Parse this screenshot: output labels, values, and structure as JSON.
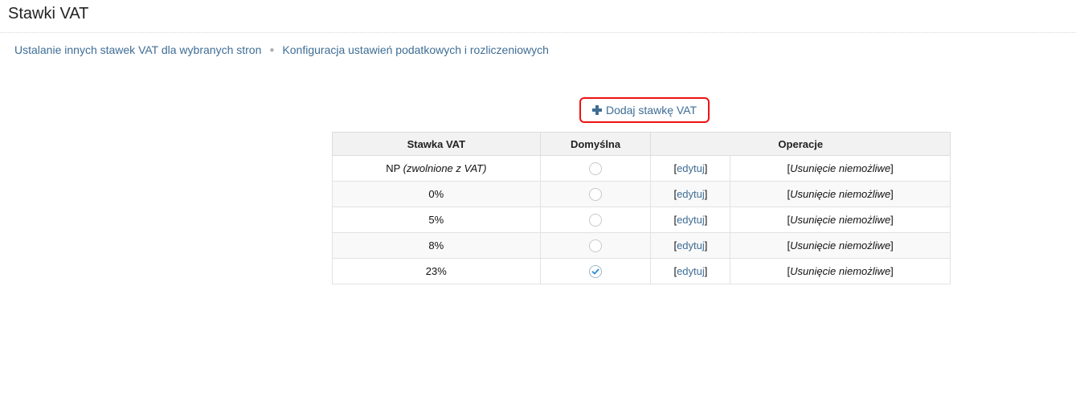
{
  "page": {
    "title": "Stawki VAT"
  },
  "links": [
    {
      "label": "Ustalanie innych stawek VAT dla wybranych stron"
    },
    {
      "label": "Konfiguracja ustawień podatkowych i rozliczeniowych"
    }
  ],
  "add_button": {
    "label": "Dodaj stawkę VAT",
    "icon": "plus-icon"
  },
  "table": {
    "headers": {
      "rate": "Stawka VAT",
      "default": "Domyślna",
      "operations": "Operacje"
    },
    "rows": [
      {
        "rate": "NP",
        "rate_note": "(zwolnione z VAT)",
        "default": false,
        "edit": "edytuj",
        "delete": "Usunięcie niemożliwe"
      },
      {
        "rate": "0%",
        "rate_note": "",
        "default": false,
        "edit": "edytuj",
        "delete": "Usunięcie niemożliwe"
      },
      {
        "rate": "5%",
        "rate_note": "",
        "default": false,
        "edit": "edytuj",
        "delete": "Usunięcie niemożliwe"
      },
      {
        "rate": "8%",
        "rate_note": "",
        "default": false,
        "edit": "edytuj",
        "delete": "Usunięcie niemożliwe"
      },
      {
        "rate": "23%",
        "rate_note": "",
        "default": true,
        "edit": "edytuj",
        "delete": "Usunięcie niemożliwe"
      }
    ]
  },
  "colors": {
    "link": "#3e6d95",
    "highlight_border": "#ee1111",
    "header_bg": "#f2f2f2",
    "check": "#2a8dd4"
  }
}
